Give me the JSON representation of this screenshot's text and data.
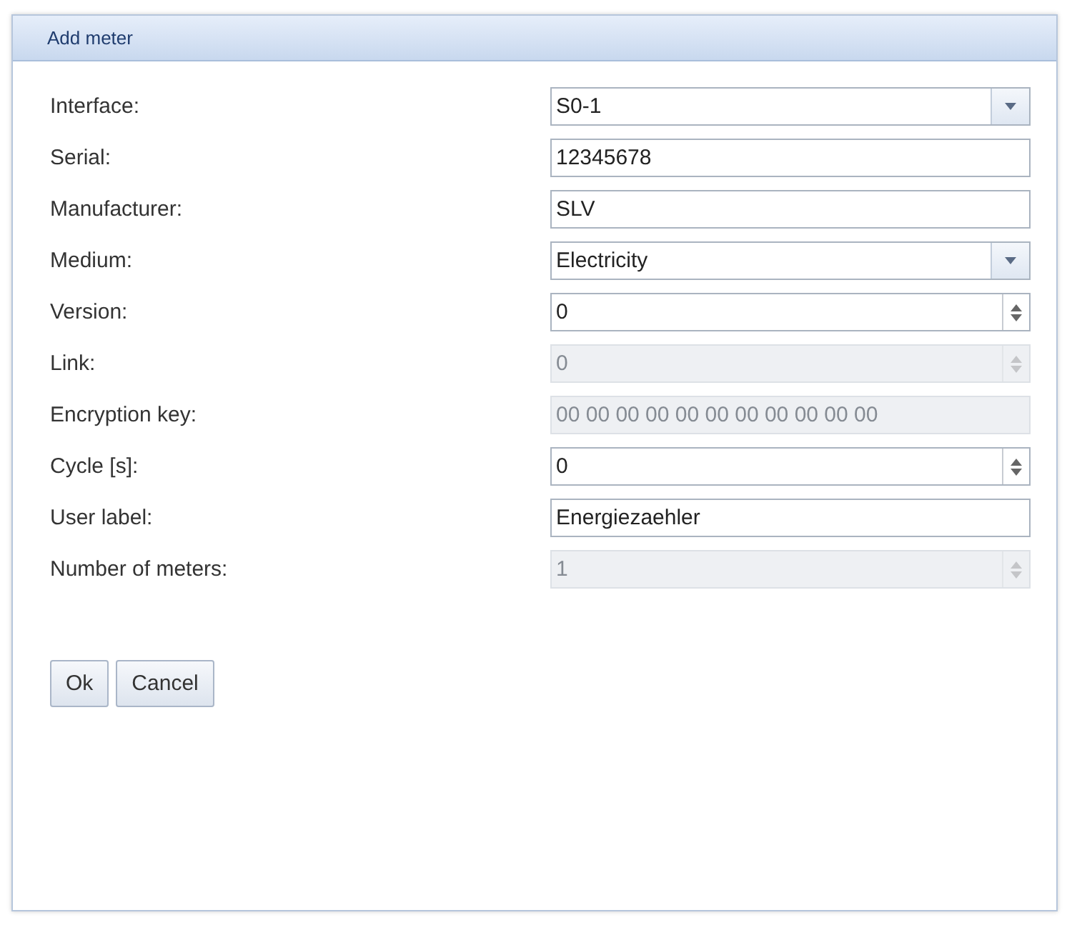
{
  "dialog": {
    "title": "Add meter"
  },
  "fields": [
    {
      "label": "Interface:",
      "kind": "select",
      "value": "S0-1",
      "disabled": false
    },
    {
      "label": "Serial:",
      "kind": "text",
      "value": "12345678",
      "disabled": false
    },
    {
      "label": "Manufacturer:",
      "kind": "text",
      "value": "SLV",
      "disabled": false
    },
    {
      "label": "Medium:",
      "kind": "select",
      "value": "Electricity",
      "disabled": false
    },
    {
      "label": "Version:",
      "kind": "spinner",
      "value": "0",
      "disabled": false
    },
    {
      "label": "Link:",
      "kind": "spinner",
      "value": "0",
      "disabled": true
    },
    {
      "label": "Encryption key:",
      "kind": "text",
      "value": "00 00 00 00 00 00 00 00 00 00 00",
      "disabled": true
    },
    {
      "label": "Cycle [s]:",
      "kind": "spinner",
      "value": "0",
      "disabled": false
    },
    {
      "label": "User label:",
      "kind": "text",
      "value": "Energiezaehler",
      "disabled": false
    },
    {
      "label": "Number of meters:",
      "kind": "spinner",
      "value": "1",
      "disabled": true
    }
  ],
  "buttons": [
    "Ok",
    "Cancel"
  ]
}
